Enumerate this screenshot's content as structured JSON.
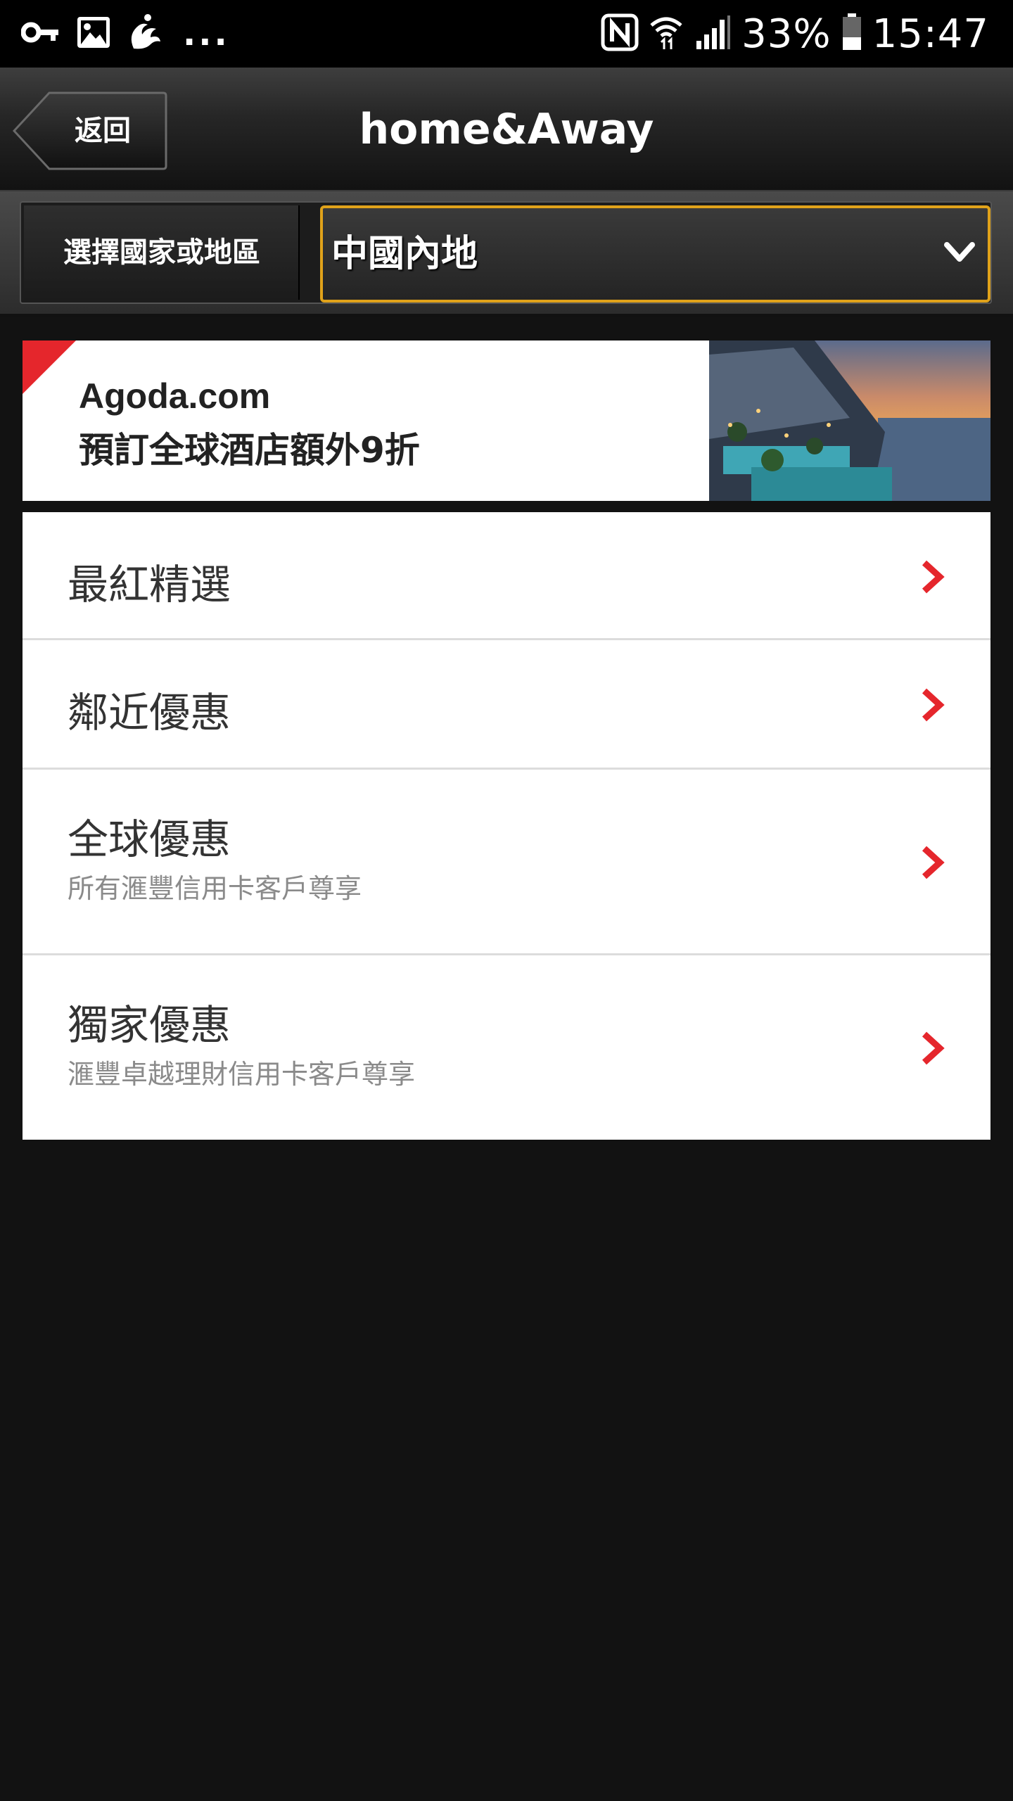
{
  "status_bar": {
    "icons_left": [
      "key-icon",
      "image-icon",
      "uc-browser-icon"
    ],
    "overflow": "...",
    "icons_right": [
      "nfc-icon",
      "wifi-icon",
      "signal-icon"
    ],
    "battery_percent": "33%",
    "time": "15:47"
  },
  "header": {
    "back_label": "返回",
    "title": "home&Away"
  },
  "region_selector": {
    "label": "選擇國家或地區",
    "selected": "中國內地",
    "accent": "#e0a21a"
  },
  "ad": {
    "title": "Agoda.com",
    "subtitle": "預訂全球酒店額外9折",
    "corner_color": "#e5262c"
  },
  "menu": {
    "items": [
      {
        "label": "最紅精選",
        "sub": ""
      },
      {
        "label": "鄰近優惠",
        "sub": ""
      },
      {
        "label": "全球優惠",
        "sub": "所有滙豐信用卡客戶尊享"
      },
      {
        "label": "獨家優惠",
        "sub": "滙豐卓越理財信用卡客戶尊享"
      }
    ],
    "arrow_color": "#e5262c"
  }
}
